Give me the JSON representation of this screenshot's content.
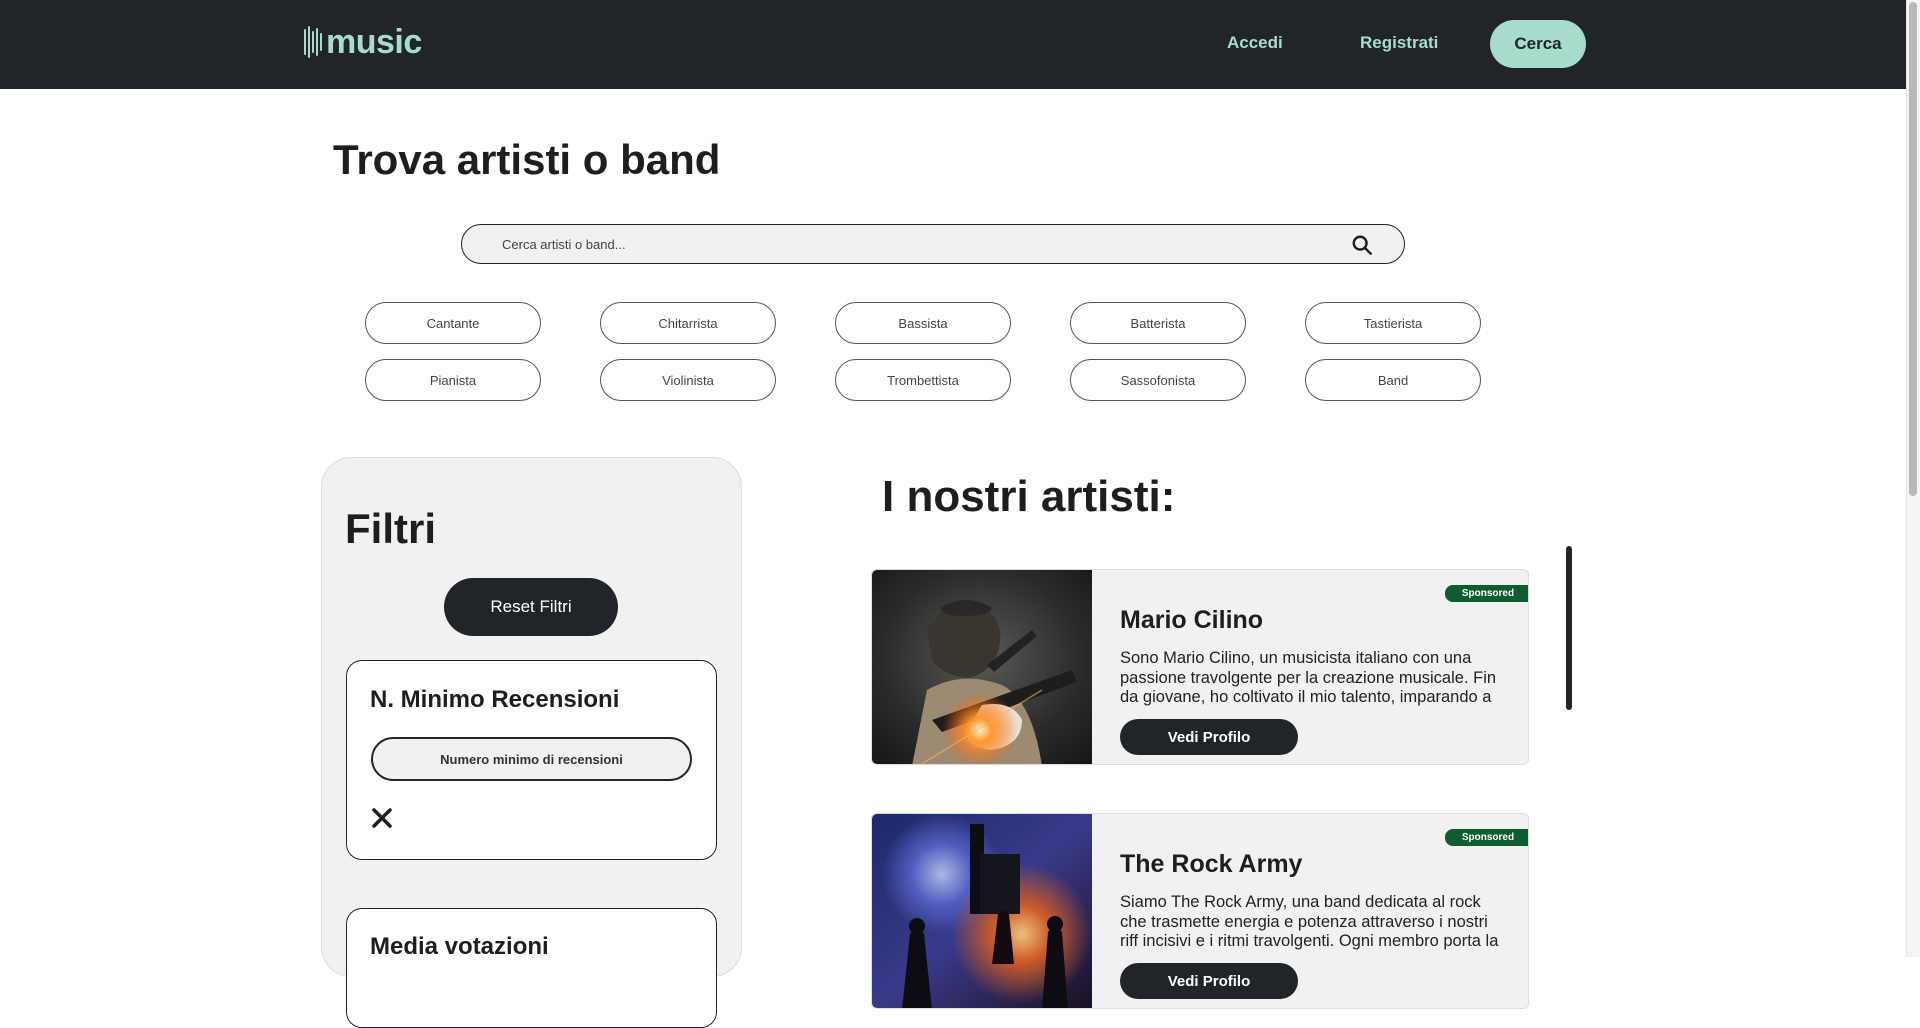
{
  "navbar": {
    "logo_text": "music",
    "login": "Accedi",
    "register": "Registrati",
    "search": "Cerca"
  },
  "page": {
    "title": "Trova artisti o band"
  },
  "search": {
    "placeholder": "Cerca artisti o band..."
  },
  "categories": [
    "Cantante",
    "Chitarrista",
    "Bassista",
    "Batterista",
    "Tastierista",
    "Pianista",
    "Violinista",
    "Trombettista",
    "Sassofonista",
    "Band"
  ],
  "filters": {
    "title": "Filtri",
    "reset": "Reset Filtri",
    "min_reviews": {
      "title": "N. Minimo Recensioni",
      "placeholder": "Numero minimo di recensioni"
    },
    "avg_rating": {
      "title": "Media votazioni"
    }
  },
  "artists_section": {
    "title": "I nostri artisti:",
    "artists": [
      {
        "name": "Mario Cilino",
        "badge": "Sponsored",
        "bio": "Sono Mario Cilino, un musicista italiano con una passione travolgente per la creazione musicale. Fin da giovane, ho coltivato il mio talento, imparando a",
        "button": "Vedi Profilo",
        "photo_icon": "guitarist-photo"
      },
      {
        "name": "The Rock Army",
        "badge": "Sponsored",
        "bio": "Siamo The Rock Army, una band dedicata al rock che trasmette energia e potenza attraverso i nostri riff incisivi e i ritmi travolgenti. Ogni membro porta la",
        "button": "Vedi Profilo",
        "photo_icon": "concert-photo"
      }
    ]
  },
  "colors": {
    "navbar_bg": "#212529",
    "accent": "#a7dccd",
    "sponsored_bg": "#0f5c2e",
    "panel_bg": "#f1f1f1"
  }
}
